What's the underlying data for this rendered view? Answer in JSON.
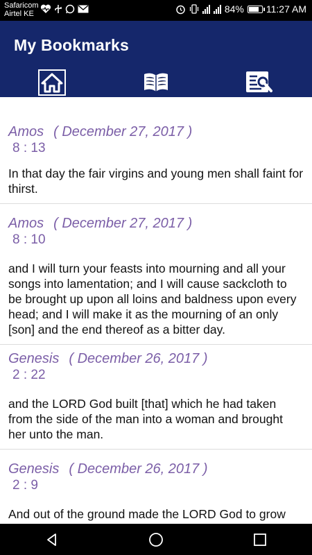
{
  "status_bar": {
    "carrier_1": "Safaricom",
    "carrier_2": "Airtel KE",
    "battery": "84%",
    "time": "11:27 AM"
  },
  "header": {
    "title": "My Bookmarks",
    "tabs": [
      {
        "name": "home",
        "icon": "home-icon",
        "selected": true
      },
      {
        "name": "bible",
        "icon": "open-book-icon",
        "selected": false
      },
      {
        "name": "search",
        "icon": "book-search-icon",
        "selected": false
      }
    ]
  },
  "bookmarks": [
    {
      "book": "Amos",
      "date": "( December 27, 2017 )",
      "reference": "8 : 13",
      "text": "In that day the fair virgins and young men shall faint for thirst."
    },
    {
      "book": "Amos",
      "date": "( December 27, 2017 )",
      "reference": "8 : 10",
      "text": "and I will turn your feasts into mourning and all your songs into lamentation; and I will cause sackcloth to be brought up upon all loins and baldness upon every head; and I will make it as the mourning of an only [son] and the end thereof as a bitter day."
    },
    {
      "book": "Genesis",
      "date": "( December 26, 2017 )",
      "reference": "2 : 22",
      "text": "and the LORD God built [that] which he had taken from the side of the man into a woman and brought her unto the man."
    },
    {
      "book": "Genesis",
      "date": "( December 26, 2017 )",
      "reference": "2 : 9",
      "text": "And out of the ground made the LORD God to grow every tree that is desirable to the sight and good for"
    }
  ],
  "colors": {
    "header": "#15276b",
    "accent_text": "#7b5ea7"
  },
  "battery_level": 0.84
}
